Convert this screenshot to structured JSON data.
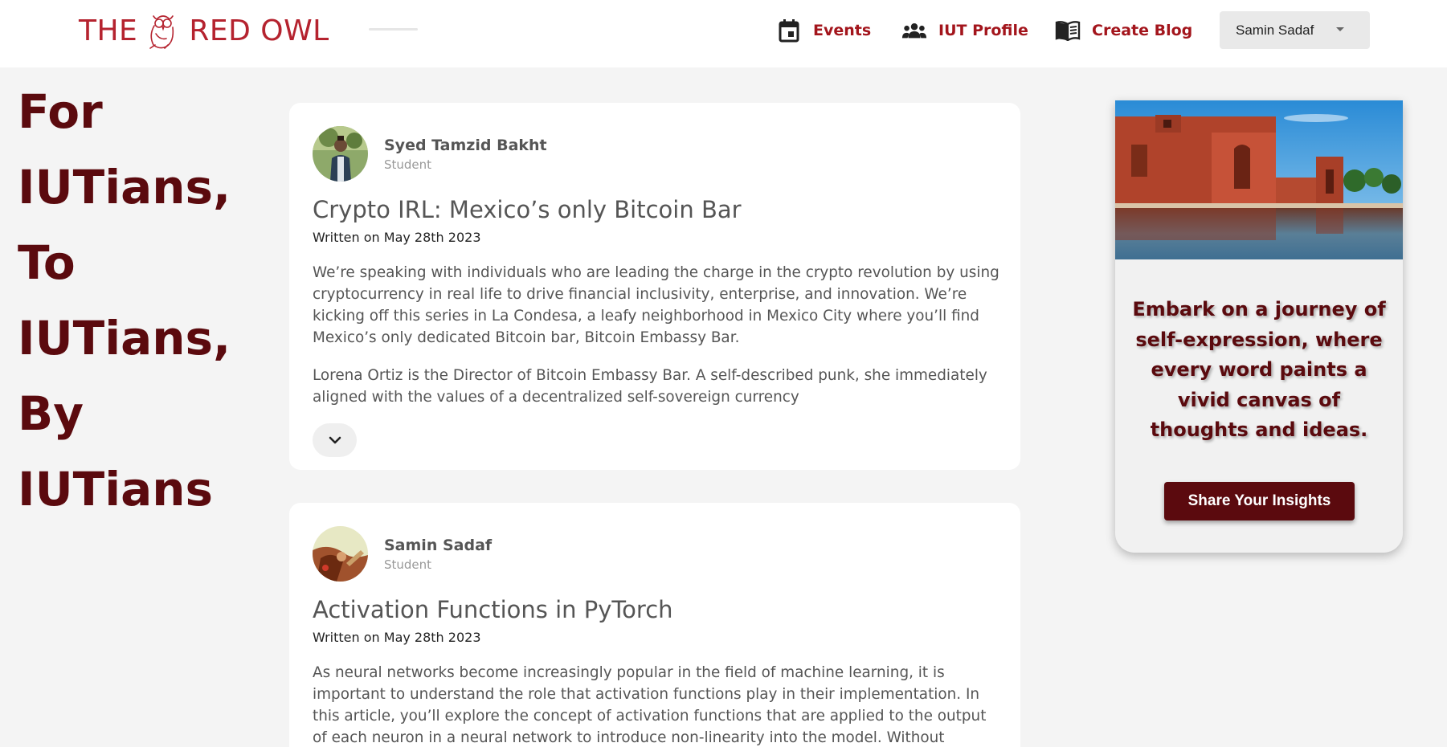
{
  "header": {
    "logo_text_left": "THE",
    "logo_text_right": "RED OWL",
    "nav": [
      {
        "label": "Events",
        "icon": "calendar-icon"
      },
      {
        "label": "IUT Profile",
        "icon": "people-icon"
      },
      {
        "label": "Create Blog",
        "icon": "book-icon"
      }
    ],
    "user": {
      "name": "Samin Sadaf"
    }
  },
  "hero": {
    "lines": [
      "For",
      "IUTians,",
      "To",
      "IUTians,",
      "By",
      "IUTians"
    ]
  },
  "posts": [
    {
      "author": "Syed Tamzid Bakht",
      "role": "Student",
      "title": "Crypto IRL: Mexico’s only Bitcoin Bar",
      "date": "Written on May 28th 2023",
      "paragraphs": [
        "We’re speaking with individuals who are leading the charge in the crypto revolution by using cryptocurrency in real life to drive financial inclusivity, enterprise, and innovation. We’re kicking off this series in La Condesa, a leafy neighborhood in Mexico City where you’ll find Mexico’s only dedicated Bitcoin bar, Bitcoin Embassy Bar.",
        "Lorena Ortiz is the Director of Bitcoin Embassy Bar. A self-described punk, she immediately aligned with the values of a decentralized self-sovereign currency"
      ]
    },
    {
      "author": "Samin Sadaf",
      "role": "Student",
      "title": "Activation Functions in PyTorch",
      "date": "Written on May 28th 2023",
      "paragraphs": [
        "As neural networks become increasingly popular in the field of machine learning, it is important to understand the role that activation functions play in their implementation. In this article, you’ll explore the concept of activation functions that are applied to the output of each neuron in a neural network to introduce non-linearity into the model. Without"
      ]
    }
  ],
  "promo": {
    "text": "Embark on a journey of self-expression, where every word paints a vivid canvas of thoughts and ideas.",
    "button": "Share Your Insights"
  },
  "colors": {
    "brand": "#a3151c",
    "hero": "#5b0a0e"
  }
}
